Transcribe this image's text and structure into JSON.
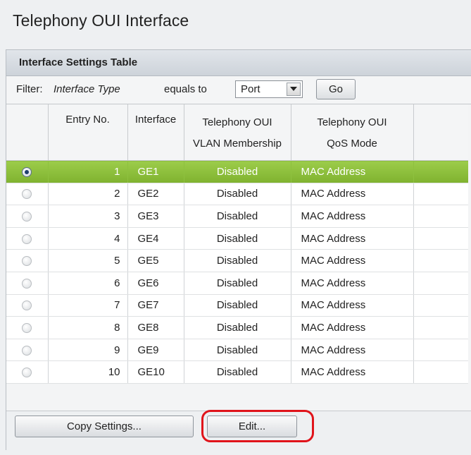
{
  "page": {
    "title": "Telephony OUI Interface"
  },
  "panel": {
    "header": "Interface Settings Table"
  },
  "filter": {
    "label_prefix": "Filter:",
    "field": "Interface Type",
    "operator": "equals to",
    "select_value": "Port",
    "go_label": "Go"
  },
  "table": {
    "columns": {
      "entry": "Entry No.",
      "interface": "Interface",
      "vlan_line1": "Telephony OUI",
      "vlan_line2": "VLAN Membership",
      "qos_line1": "Telephony OUI",
      "qos_line2": "QoS Mode"
    },
    "rows": [
      {
        "entry": "1",
        "interface": "GE1",
        "vlan": "Disabled",
        "qos": "MAC Address",
        "selected": true
      },
      {
        "entry": "2",
        "interface": "GE2",
        "vlan": "Disabled",
        "qos": "MAC Address",
        "selected": false
      },
      {
        "entry": "3",
        "interface": "GE3",
        "vlan": "Disabled",
        "qos": "MAC Address",
        "selected": false
      },
      {
        "entry": "4",
        "interface": "GE4",
        "vlan": "Disabled",
        "qos": "MAC Address",
        "selected": false
      },
      {
        "entry": "5",
        "interface": "GE5",
        "vlan": "Disabled",
        "qos": "MAC Address",
        "selected": false
      },
      {
        "entry": "6",
        "interface": "GE6",
        "vlan": "Disabled",
        "qos": "MAC Address",
        "selected": false
      },
      {
        "entry": "7",
        "interface": "GE7",
        "vlan": "Disabled",
        "qos": "MAC Address",
        "selected": false
      },
      {
        "entry": "8",
        "interface": "GE8",
        "vlan": "Disabled",
        "qos": "MAC Address",
        "selected": false
      },
      {
        "entry": "9",
        "interface": "GE9",
        "vlan": "Disabled",
        "qos": "MAC Address",
        "selected": false
      },
      {
        "entry": "10",
        "interface": "GE10",
        "vlan": "Disabled",
        "qos": "MAC Address",
        "selected": false
      }
    ]
  },
  "actions": {
    "copy_settings_label": "Copy Settings...",
    "edit_label": "Edit..."
  },
  "colors": {
    "selected_row": "#8cc03a",
    "highlight_ring": "#e0141b"
  }
}
